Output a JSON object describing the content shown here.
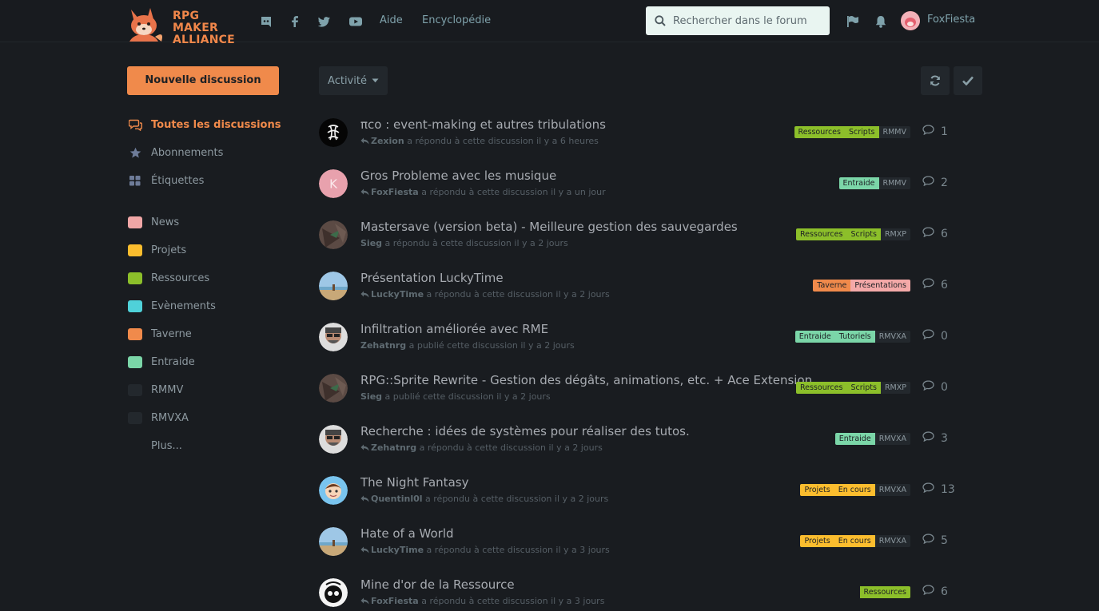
{
  "header": {
    "logo_text_line1": "RPG MAKER",
    "logo_text_line2": "ALLIANCE",
    "links": [
      "Aide",
      "Encyclopédie"
    ],
    "search_placeholder": "Rechercher dans le forum",
    "username": "FoxFiesta",
    "icons": [
      "discord-icon",
      "facebook-icon",
      "twitter-icon",
      "youtube-icon",
      "flag-icon",
      "bell-icon"
    ]
  },
  "sidebar": {
    "new_discussion": "Nouvelle discussion",
    "nav": [
      {
        "label": "Toutes les discussions",
        "icon": "comments-icon"
      },
      {
        "label": "Abonnements",
        "icon": "star-icon"
      },
      {
        "label": "Étiquettes",
        "icon": "grid-icon"
      }
    ],
    "tags": [
      {
        "label": "News",
        "color": "#f0a6a6"
      },
      {
        "label": "Projets",
        "color": "#fbbd2e"
      },
      {
        "label": "Ressources",
        "color": "#8cbf2a"
      },
      {
        "label": "Evènements",
        "color": "#4fd1d9"
      },
      {
        "label": "Taverne",
        "color": "#f08a4b"
      },
      {
        "label": "Entraide",
        "color": "#7bd6a8"
      },
      {
        "label": "RMMV",
        "color": "#23282d"
      },
      {
        "label": "RMVXA",
        "color": "#23282d"
      }
    ],
    "more": "Plus..."
  },
  "toolbar": {
    "sort_label": "Activité"
  },
  "colors": {
    "accent": "#f08a4b",
    "ressources": "#8cbf2a",
    "entraide": "#7bd6a8",
    "projets": "#fbbd2e",
    "taverne": "#f08a4b",
    "presentations": "#f4a9a8"
  },
  "discussions": [
    {
      "title": "πco : event-making et autres tribulations",
      "user": "Zexion",
      "reply": true,
      "action": "a répondu à cette discussion il y a 6 heures",
      "count": "1",
      "tags": [
        {
          "t": "Ressources",
          "c": "#8cbf2a"
        },
        {
          "t": "Scripts",
          "c": "#8cbf2a"
        },
        {
          "t": "RMMV",
          "c": ""
        }
      ]
    },
    {
      "title": "Gros Probleme avec les musique",
      "user": "FoxFiesta",
      "reply": true,
      "action": "a répondu à cette discussion il y a un jour",
      "count": "2",
      "tags": [
        {
          "t": "Entraide",
          "c": "#7bd6a8"
        },
        {
          "t": "RMMV",
          "c": ""
        }
      ]
    },
    {
      "title": "Mastersave (version beta) - Meilleure gestion des sauvegardes",
      "user": "Sieg",
      "reply": false,
      "action": "a répondu à cette discussion il y a 2 jours",
      "count": "6",
      "tags": [
        {
          "t": "Ressources",
          "c": "#8cbf2a"
        },
        {
          "t": "Scripts",
          "c": "#8cbf2a"
        },
        {
          "t": "RMXP",
          "c": ""
        }
      ]
    },
    {
      "title": "Présentation LuckyTime",
      "user": "LuckyTime",
      "reply": true,
      "action": "a répondu à cette discussion il y a 2 jours",
      "count": "6",
      "tags": [
        {
          "t": "Taverne",
          "c": "#f08a4b"
        },
        {
          "t": "Présentations",
          "c": "#f4a9a8"
        }
      ]
    },
    {
      "title": "Infiltration améliorée avec RME",
      "user": "Zehatnrg",
      "reply": false,
      "action": "a publié cette discussion il y a 2 jours",
      "count": "0",
      "tags": [
        {
          "t": "Entraide",
          "c": "#7bd6a8"
        },
        {
          "t": "Tutoriels",
          "c": "#7bd6a8"
        },
        {
          "t": "RMVXA",
          "c": ""
        }
      ]
    },
    {
      "title": "RPG::Sprite Rewrite - Gestion des dégâts, animations, etc. + Ace Extension",
      "user": "Sieg",
      "reply": false,
      "action": "a publié cette discussion il y a 2 jours",
      "count": "0",
      "tags": [
        {
          "t": "Ressources",
          "c": "#8cbf2a"
        },
        {
          "t": "Scripts",
          "c": "#8cbf2a"
        },
        {
          "t": "RMXP",
          "c": ""
        }
      ]
    },
    {
      "title": "Recherche : idées de systèmes pour réaliser des tutos.",
      "user": "Zehatnrg",
      "reply": true,
      "action": "a répondu à cette discussion il y a 2 jours",
      "count": "3",
      "tags": [
        {
          "t": "Entraide",
          "c": "#7bd6a8"
        },
        {
          "t": "RMVXA",
          "c": ""
        }
      ]
    },
    {
      "title": "The Night Fantasy",
      "user": "Quentinl0l",
      "reply": true,
      "action": "a répondu à cette discussion il y a 2 jours",
      "count": "13",
      "tags": [
        {
          "t": "Projets",
          "c": "#fbbd2e"
        },
        {
          "t": "En cours",
          "c": "#fbbd2e"
        },
        {
          "t": "RMVXA",
          "c": ""
        }
      ]
    },
    {
      "title": "Hate of a World",
      "user": "LuckyTime",
      "reply": true,
      "action": "a répondu à cette discussion il y a 3 jours",
      "count": "5",
      "tags": [
        {
          "t": "Projets",
          "c": "#fbbd2e"
        },
        {
          "t": "En cours",
          "c": "#fbbd2e"
        },
        {
          "t": "RMVXA",
          "c": ""
        }
      ]
    },
    {
      "title": "Mine d'or de la Ressource",
      "user": "FoxFiesta",
      "reply": true,
      "action": "a répondu à cette discussion il y a 3 jours",
      "count": "6",
      "tags": [
        {
          "t": "Ressources",
          "c": "#8cbf2a"
        }
      ]
    }
  ]
}
